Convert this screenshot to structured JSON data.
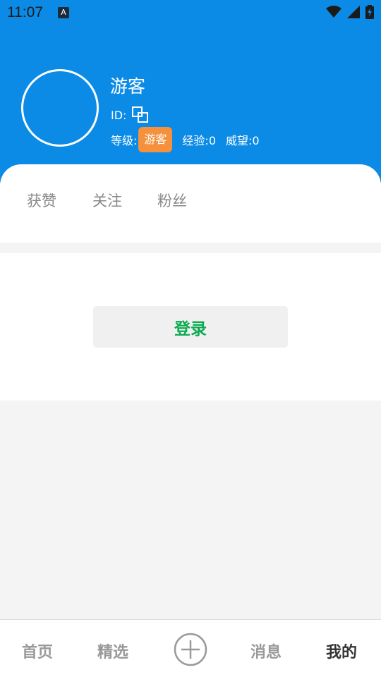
{
  "status_bar": {
    "time": "11:07",
    "app_icon_letter": "A",
    "icons": [
      "wifi-icon",
      "signal-icon",
      "battery-charging-icon"
    ]
  },
  "profile": {
    "username": "游客",
    "id_label": "ID:",
    "level_label": "等级:",
    "level_value": "游客",
    "experience": "经验:0",
    "prestige": "威望:0"
  },
  "stats": {
    "likes_label": "获赞",
    "following_label": "关注",
    "fans_label": "粉丝"
  },
  "login": {
    "button_label": "登录"
  },
  "bottom_nav": {
    "home": "首页",
    "featured": "精选",
    "add_icon": "plus-circle-icon",
    "messages": "消息",
    "mine": "我的"
  },
  "colors": {
    "header_bg": "#0b8be6",
    "level_badge": "#f5913c",
    "login_text": "#0bab4f",
    "nav_active": "#333333",
    "nav_inactive": "#999999"
  }
}
